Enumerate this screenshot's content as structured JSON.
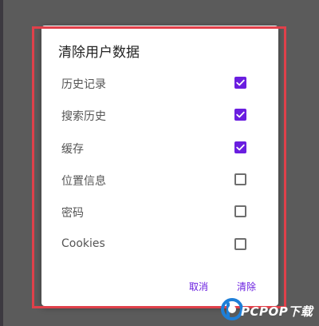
{
  "dialog": {
    "title": "清除用户数据",
    "options": [
      {
        "label": "历史记录",
        "checked": true
      },
      {
        "label": "搜索历史",
        "checked": true
      },
      {
        "label": "缓存",
        "checked": true
      },
      {
        "label": "位置信息",
        "checked": false
      },
      {
        "label": "密码",
        "checked": false
      },
      {
        "label": "Cookies",
        "checked": false
      }
    ],
    "cancel_label": "取消",
    "clear_label": "清除"
  },
  "watermark": {
    "text": "PCPOP下载"
  },
  "colors": {
    "accent": "#6a1ee0",
    "highlight_border": "#e0404a",
    "backdrop": "#5b5b5b"
  }
}
